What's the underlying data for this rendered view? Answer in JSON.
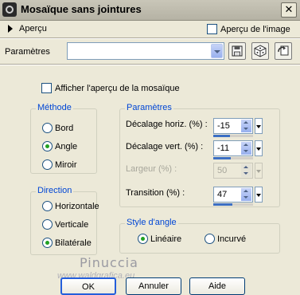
{
  "window": {
    "title": "Mosaïque sans jointures",
    "close_glyph": "✕"
  },
  "preview": {
    "toggle_label": "Aperçu",
    "image_preview_label": "Aperçu de l'image"
  },
  "presets": {
    "label": "Paramètres",
    "value": ""
  },
  "mosaic_preview_label": "Afficher l'aperçu de la mosaïque",
  "method": {
    "title": "Méthode",
    "options": [
      "Bord",
      "Angle",
      "Miroir"
    ],
    "selected": "Angle"
  },
  "direction": {
    "title": "Direction",
    "options": [
      "Horizontale",
      "Verticale",
      "Bilatérale"
    ],
    "selected": "Bilatérale"
  },
  "parameters": {
    "title": "Paramètres",
    "h_offset": {
      "label": "Décalage horiz. (%) :",
      "value": "-15",
      "fraction": 0.42
    },
    "v_offset": {
      "label": "Décalage vert. (%) :",
      "value": "-11",
      "fraction": 0.44
    },
    "width": {
      "label": "Largeur (%) :",
      "value": "50",
      "disabled": true
    },
    "transition": {
      "label": "Transition (%) :",
      "value": "47",
      "fraction": 0.47
    }
  },
  "corner_style": {
    "title": "Style d'angle",
    "options": [
      "Linéaire",
      "Incurvé"
    ],
    "selected": "Linéaire"
  },
  "watermark": {
    "name": "Pinuccia",
    "site": "www.waldgrafica.eu"
  },
  "buttons": {
    "ok": "OK",
    "cancel": "Annuler",
    "help": "Aide"
  },
  "icons": {
    "save": "save-icon",
    "randomize": "dice-icon",
    "reset": "reset-icon"
  }
}
